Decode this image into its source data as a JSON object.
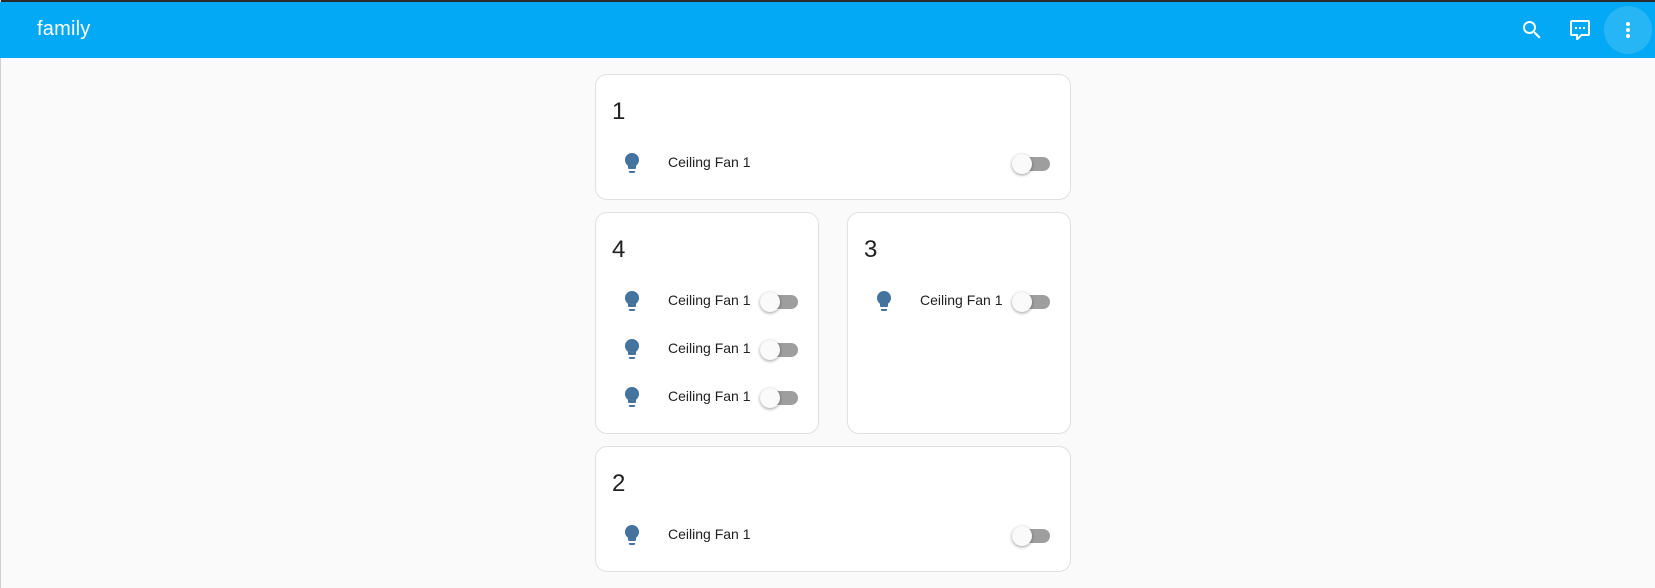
{
  "app": {
    "title": "family"
  },
  "toolbar": {
    "search_icon": "search-icon",
    "assist_icon": "chat-icon",
    "menu_icon": "more-vertical-icon"
  },
  "colors": {
    "appbar": "#03a9f4",
    "entity_icon": "#44739e",
    "toggle_track_off": "#9e9e9e",
    "background": "#fafafa"
  },
  "cards": [
    {
      "title": "1",
      "entities": [
        {
          "name": "Ceiling Fan 1",
          "icon": "lightbulb-icon",
          "state": "off"
        }
      ]
    },
    {
      "title": "4",
      "entities": [
        {
          "name": "Ceiling Fan 1",
          "icon": "lightbulb-icon",
          "state": "off"
        },
        {
          "name": "Ceiling Fan 1",
          "icon": "lightbulb-icon",
          "state": "off"
        },
        {
          "name": "Ceiling Fan 1",
          "icon": "lightbulb-icon",
          "state": "off"
        }
      ]
    },
    {
      "title": "3",
      "entities": [
        {
          "name": "Ceiling Fan 1",
          "icon": "lightbulb-icon",
          "state": "off"
        }
      ]
    },
    {
      "title": "2",
      "entities": [
        {
          "name": "Ceiling Fan 1",
          "icon": "lightbulb-icon",
          "state": "off"
        }
      ]
    }
  ]
}
